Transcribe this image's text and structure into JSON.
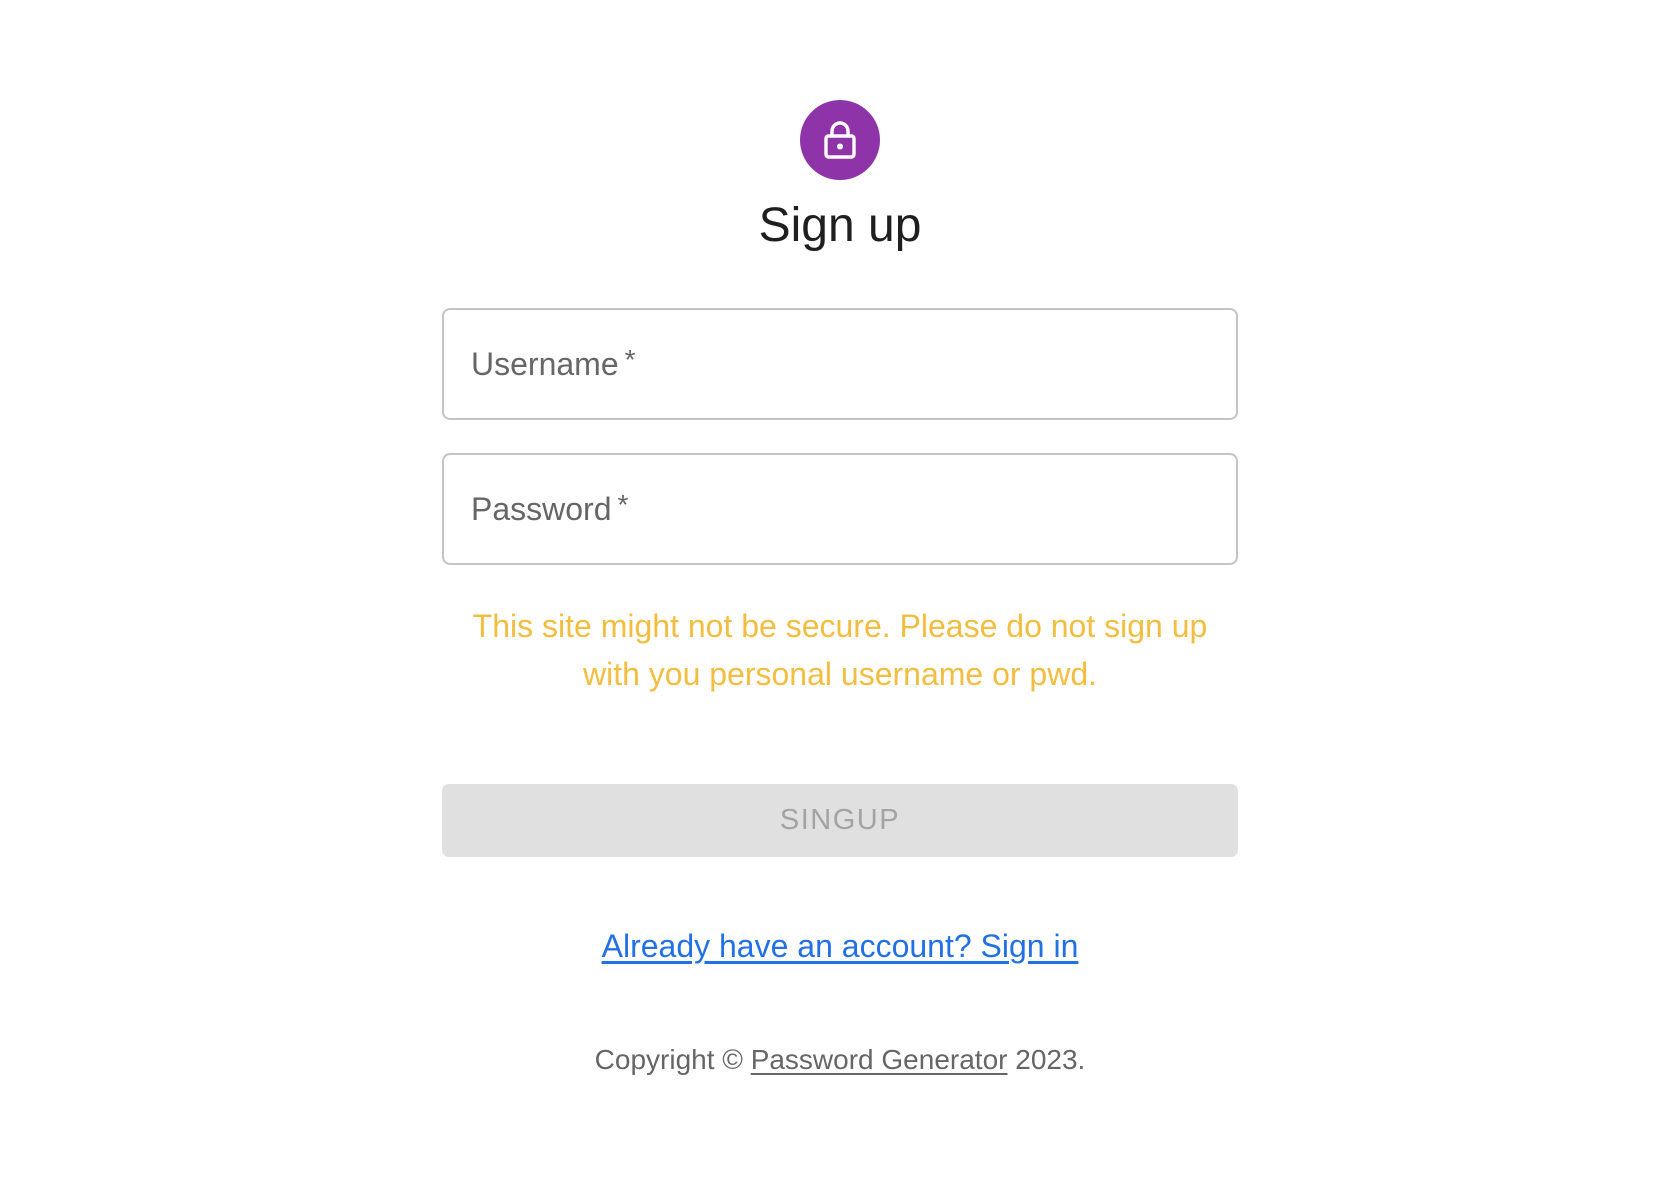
{
  "header": {
    "icon": "lock-icon",
    "title": "Sign up"
  },
  "form": {
    "username": {
      "label": "Username",
      "required_mark": "*",
      "value": ""
    },
    "password": {
      "label": "Password",
      "required_mark": "*",
      "value": ""
    },
    "warning": "This site might not be secure. Please do not sign up with you personal username or pwd.",
    "submit_label": "SINGUP",
    "signin_link": "Already have an account? Sign in"
  },
  "footer": {
    "prefix": "Copyright ©",
    "link": "Password Generator",
    "suffix": "2023."
  },
  "colors": {
    "accent": "#8e34a8",
    "warning": "#f3bd3f",
    "link": "#2271e4",
    "button_disabled_bg": "#e0e0e0",
    "button_disabled_text": "#a3a3a3"
  }
}
